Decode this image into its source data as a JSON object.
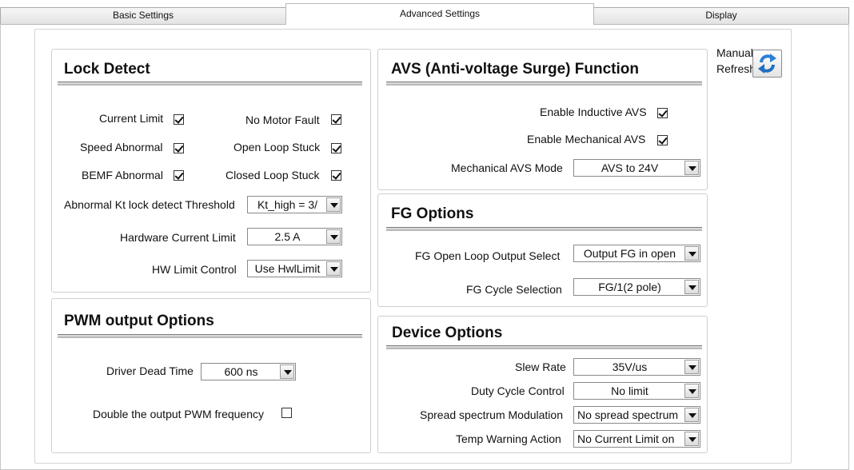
{
  "tabs": {
    "basic": "Basic Settings",
    "advanced": "Advanced Settings",
    "display": "Display"
  },
  "refresh": {
    "label_line1": "Manual",
    "label_line2": "Refresh"
  },
  "lock_detect": {
    "title": "Lock Detect",
    "current_limit": "Current Limit",
    "no_motor_fault": "No Motor Fault",
    "speed_abnormal": "Speed Abnormal",
    "open_loop_stuck": "Open Loop Stuck",
    "bemf_abnormal": "BEMF Abnormal",
    "closed_loop_stuck": "Closed Loop Stuck",
    "kt_threshold_label": "Abnormal Kt lock detect Threshold",
    "kt_threshold_value": "Kt_high = 3/",
    "hw_current_limit_label": "Hardware Current Limit",
    "hw_current_limit_value": "2.5 A",
    "hw_limit_control_label": "HW Limit Control",
    "hw_limit_control_value": "Use HwlLimit"
  },
  "pwm": {
    "title": "PWM output Options",
    "dead_time_label": "Driver Dead Time",
    "dead_time_value": "600 ns",
    "double_freq_label": "Double the output PWM frequency"
  },
  "avs": {
    "title": "AVS (Anti-voltage Surge) Function",
    "inductive_label": "Enable Inductive AVS",
    "mechanical_label": "Enable Mechanical AVS",
    "mode_label": "Mechanical AVS Mode",
    "mode_value": "AVS to 24V"
  },
  "fg": {
    "title": "FG Options",
    "open_loop_label": "FG Open Loop Output Select",
    "open_loop_value": "Output FG in open",
    "cycle_label": "FG Cycle Selection",
    "cycle_value": "FG/1(2 pole)"
  },
  "device": {
    "title": "Device Options",
    "slew_label": "Slew Rate",
    "slew_value": "35V/us",
    "duty_label": "Duty Cycle Control",
    "duty_value": "No limit",
    "spread_label": "Spread spectrum Modulation",
    "spread_value": "No spread spectrum",
    "temp_label": "Temp Warning Action",
    "temp_value": "No Current Limit on"
  },
  "checkbox_states": {
    "current_limit": true,
    "no_motor_fault": true,
    "speed_abnormal": true,
    "open_loop_stuck": true,
    "bemf_abnormal": true,
    "closed_loop_stuck": true,
    "double_pwm": false,
    "inductive_avs": true,
    "mechanical_avs": true
  },
  "icons": {
    "refresh": "refresh-icon"
  },
  "colors": {
    "refresh_blue": "#2a7fd6",
    "panel_border": "#cfcfcf"
  }
}
